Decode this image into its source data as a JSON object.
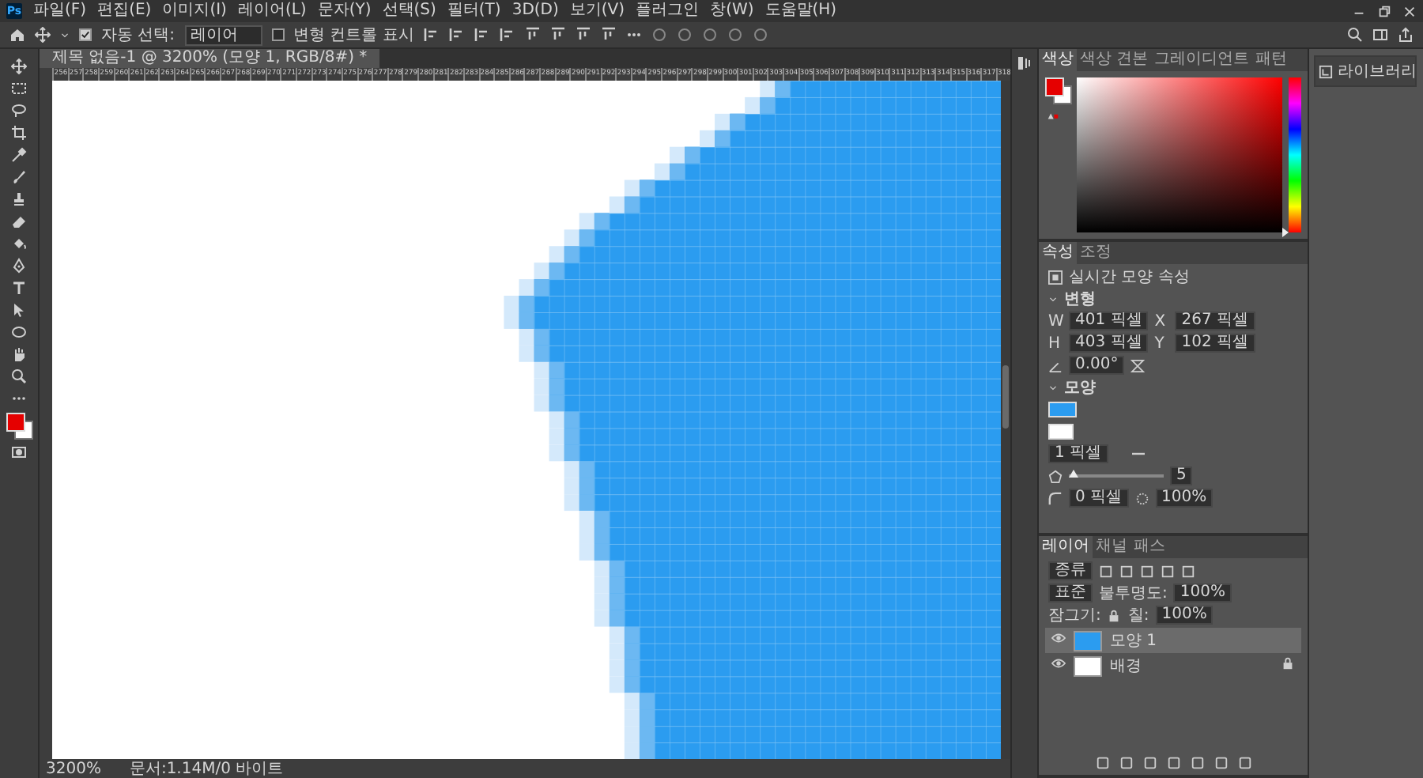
{
  "app_logo": "Ps",
  "menu": [
    "파일(F)",
    "편집(E)",
    "이미지(I)",
    "레이어(L)",
    "문자(Y)",
    "선택(S)",
    "필터(T)",
    "3D(D)",
    "보기(V)",
    "플러그인",
    "창(W)",
    "도움말(H)"
  ],
  "options_bar": {
    "auto_select_checked": true,
    "auto_select_label": "자동 선택:",
    "auto_select_target": "레이어",
    "transform_controls_checked": false,
    "transform_controls_label": "변형 컨트롤 표시"
  },
  "document_tab": {
    "title": "제목 없음-1 @ 3200% (모양 1, RGB/8#) *"
  },
  "ruler_labels": [
    "256",
    "257",
    "258",
    "259",
    "260",
    "261",
    "262",
    "263",
    "264",
    "265",
    "266",
    "267",
    "268",
    "269",
    "270",
    "271",
    "272",
    "273",
    "274",
    "275",
    "276",
    "277",
    "278",
    "279",
    "280",
    "281",
    "282",
    "283",
    "284",
    "285",
    "286",
    "287",
    "288",
    "289",
    "290",
    "291",
    "292",
    "293",
    "294",
    "295",
    "296",
    "297",
    "298",
    "299",
    "300",
    "301",
    "302",
    "303",
    "304",
    "305",
    "306",
    "307",
    "308",
    "309",
    "310",
    "311",
    "312",
    "313",
    "314",
    "315",
    "316",
    "317",
    "318"
  ],
  "color_panel": {
    "tabs": [
      {
        "label": "색상",
        "selected": true
      },
      {
        "label": "색상 견본",
        "selected": false
      },
      {
        "label": "그레이디언트",
        "selected": false
      },
      {
        "label": "패턴",
        "selected": false
      }
    ],
    "hue_slider": {
      "level": 0
    }
  },
  "library_panel": {
    "label": "라이브러리"
  },
  "properties_panel": {
    "tabs": [
      {
        "label": "속성",
        "selected": true
      },
      {
        "label": "조정",
        "selected": false
      }
    ],
    "subtitle": "실시간 모양 속성",
    "transform_heading": "변형",
    "fields": [
      {
        "label": "W",
        "value": "401 픽셀"
      },
      {
        "label": "X",
        "value": "267 픽셀"
      },
      {
        "label": "H",
        "value": "403 픽셀"
      },
      {
        "label": "Y",
        "value": "102 픽셀"
      }
    ],
    "angle": "0.00°",
    "appearance_heading": "모양",
    "stroke_width": "1 픽셀",
    "sides_slider": {
      "level": 0.05
    },
    "sides": "5",
    "corner_radius": "0 픽셀",
    "smoothness": "100%"
  },
  "layers_panel": {
    "tabs": [
      {
        "label": "레이어",
        "selected": true
      },
      {
        "label": "채널",
        "selected": false
      },
      {
        "label": "패스",
        "selected": false
      }
    ],
    "filter": "종류",
    "blend_mode": "표준",
    "opacity_label": "불투명도:",
    "opacity": "100%",
    "lock_label": "잠그기:",
    "fill_label": "칠:",
    "fill": "100%",
    "layers": [
      {
        "name": "모양 1",
        "kind": "shape",
        "selected": true,
        "visible": true,
        "locked": false
      },
      {
        "name": "배경",
        "kind": "background",
        "selected": false,
        "visible": true,
        "locked": true
      }
    ]
  },
  "status_bar": {
    "zoom": "3200%",
    "doc_info": "문서:1.14M/0 바이트"
  }
}
